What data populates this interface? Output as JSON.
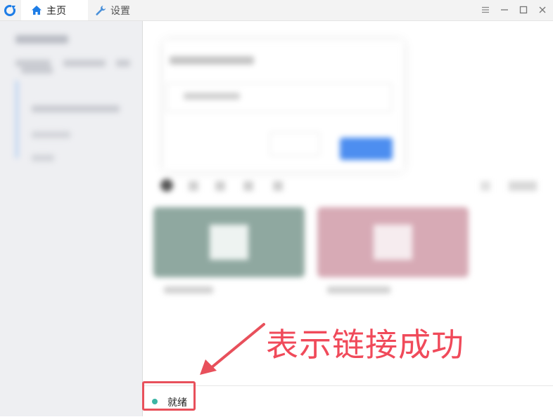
{
  "tabs": [
    {
      "label": "主页",
      "icon": "home-icon",
      "active": true
    },
    {
      "label": "设置",
      "icon": "wrench-icon",
      "active": false
    }
  ],
  "window_controls": [
    "menu-icon",
    "minimize-icon",
    "maximize-icon",
    "close-icon"
  ],
  "status": {
    "text": "就绪",
    "indicator_color": "#3bb5a4"
  },
  "annotation": {
    "text": "表示链接成功",
    "color": "#f04a5a"
  },
  "colors": {
    "accent": "#1e7de6",
    "highlight": "#e8505b"
  }
}
